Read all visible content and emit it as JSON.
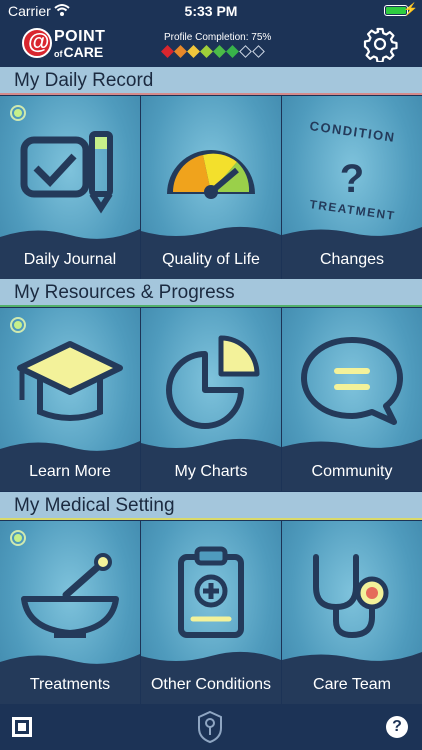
{
  "status_bar": {
    "carrier": "Carrier",
    "time": "5:33 PM"
  },
  "header": {
    "logo_line1": "POINT",
    "logo_of": "of",
    "logo_line2": "CARE",
    "profile_completion": "Profile Completion: 75%",
    "progress_percent": 75,
    "progress_diamonds": [
      "#d9262e",
      "#e8892a",
      "#f1c73c",
      "#9fcf3a",
      "#4cbb48",
      "#38b24a",
      "#ffffff",
      "#ffffff"
    ]
  },
  "sections": [
    {
      "title": "My Daily Record",
      "tiles": [
        {
          "label": "Daily Journal",
          "icon": "checkbox-pencil-icon"
        },
        {
          "label": "Quality of Life",
          "icon": "gauge-icon"
        },
        {
          "label": "Changes",
          "icon": "question-condition-treatment-icon",
          "top_text": "CONDITION",
          "bottom_text": "TREATMENT"
        }
      ]
    },
    {
      "title": "My Resources & Progress",
      "tiles": [
        {
          "label": "Learn More",
          "icon": "graduation-cap-icon"
        },
        {
          "label": "My Charts",
          "icon": "pie-chart-icon"
        },
        {
          "label": "Community",
          "icon": "speech-bubble-icon"
        }
      ]
    },
    {
      "title": "My Medical Setting",
      "tiles": [
        {
          "label": "Treatments",
          "icon": "mortar-pestle-icon"
        },
        {
          "label": "Other Conditions",
          "icon": "clipboard-medical-icon"
        },
        {
          "label": "Care Team",
          "icon": "stethoscope-icon"
        }
      ]
    }
  ],
  "footer": {
    "help": "?"
  },
  "colors": {
    "accent": "#1c3356",
    "section_bg": "#a4c6dc",
    "tile_bg": "#4f9bbd",
    "yellow": "#f3f29a"
  }
}
